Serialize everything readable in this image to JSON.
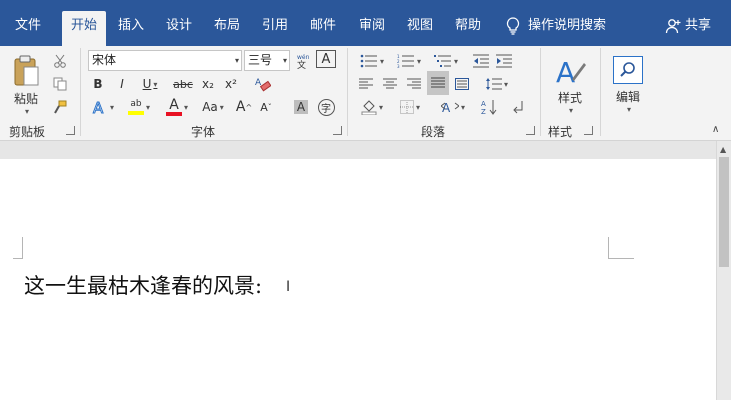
{
  "tabs": [
    {
      "label": "文件"
    },
    {
      "label": "开始"
    },
    {
      "label": "插入"
    },
    {
      "label": "设计"
    },
    {
      "label": "布局"
    },
    {
      "label": "引用"
    },
    {
      "label": "邮件"
    },
    {
      "label": "审阅"
    },
    {
      "label": "视图"
    },
    {
      "label": "帮助"
    }
  ],
  "tell_me": "操作说明搜索",
  "share": "共享",
  "ribbon": {
    "clipboard": {
      "paste": "粘贴",
      "label": "剪贴板"
    },
    "font": {
      "font_name": "宋体",
      "font_size": "三号",
      "bold": "B",
      "italic": "I",
      "underline": "U",
      "strike": "abc",
      "subscript": "x₂",
      "superscript": "x²",
      "font_color_letter": "A",
      "highlight_letters": "ab",
      "change_case": "Aa",
      "grow": "A",
      "shrink": "A",
      "char_border": "A",
      "char_shade": "A",
      "enclose": "字",
      "label": "字体"
    },
    "paragraph": {
      "label": "段落"
    },
    "styles": {
      "styles": "样式",
      "label": "样式"
    },
    "editing": {
      "editing": "编辑"
    }
  },
  "colors": {
    "brand": "#2b579a",
    "highlight": "#ffff00",
    "font_color": "#e81123"
  },
  "document": {
    "text": "这一生最枯木逢春的风景:"
  }
}
